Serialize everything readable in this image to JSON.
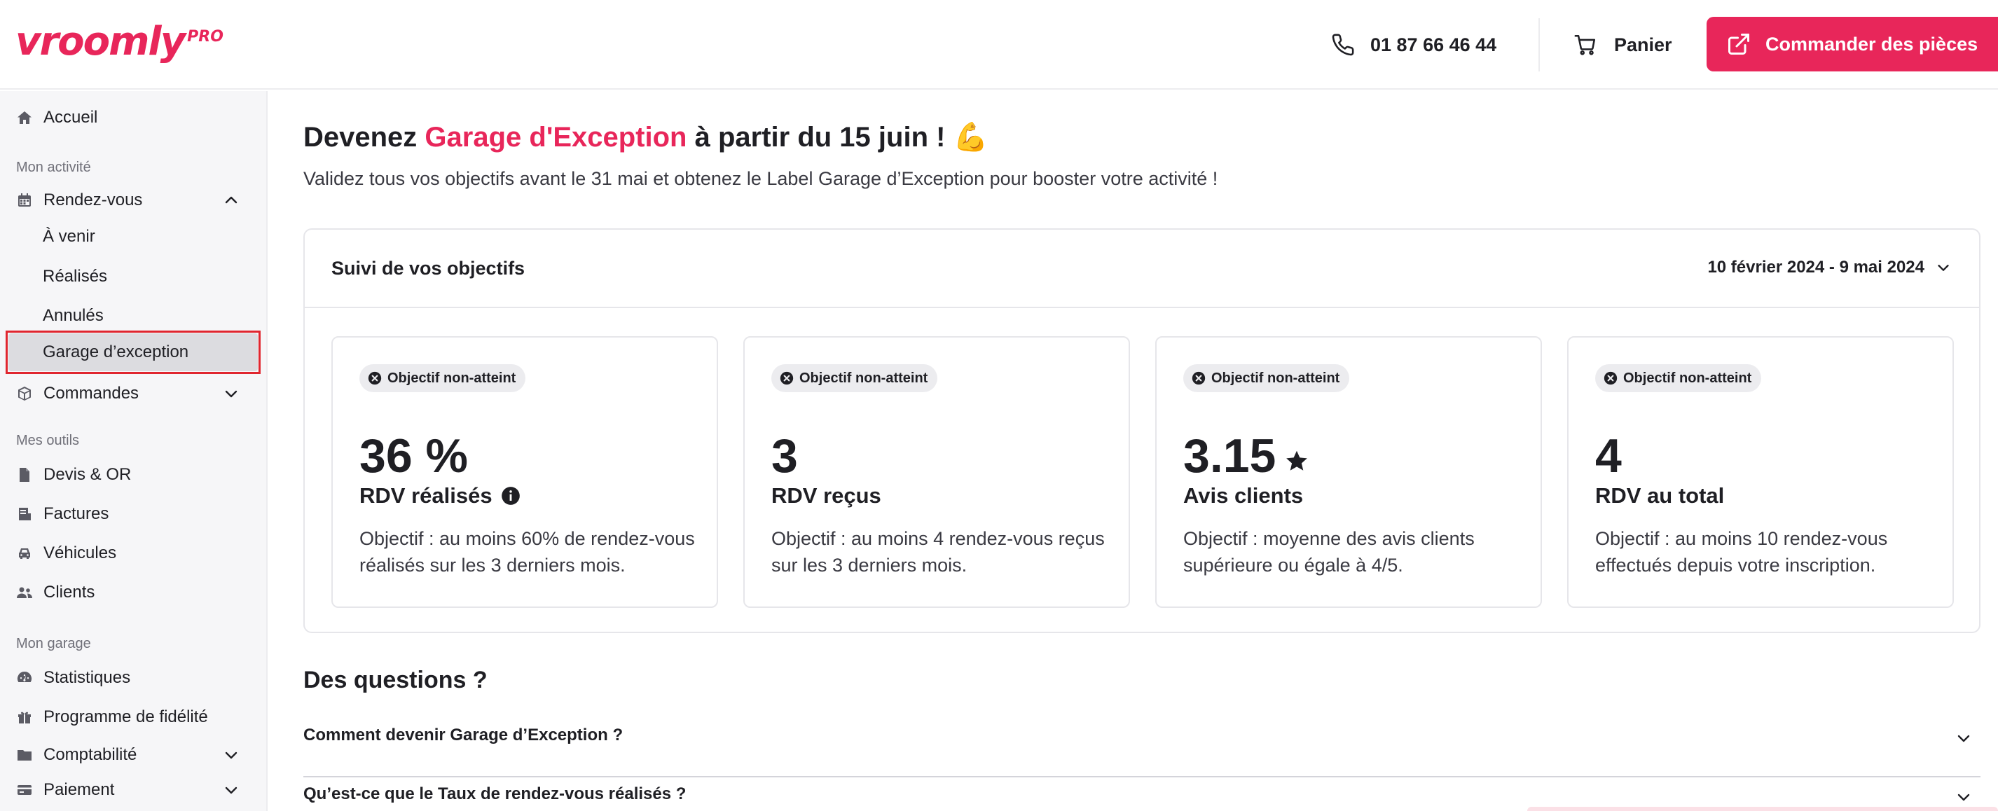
{
  "header": {
    "logo_text": "vroomly",
    "logo_suffix": "PRO",
    "phone": "01 87 66 46 44",
    "cart_label": "Panier",
    "order_button_label": "Commander des pièces",
    "accent_color": "#e8265a"
  },
  "sidebar": {
    "home": "Accueil",
    "section_activity": "Mon activité",
    "appointments": "Rendez-vous",
    "appointments_sub": [
      "À venir",
      "Réalisés",
      "Annulés",
      "Garage d’exception"
    ],
    "orders": "Commandes",
    "section_tools": "Mes outils",
    "tools": [
      "Devis & OR",
      "Factures",
      "Véhicules",
      "Clients"
    ],
    "section_garage": "Mon garage",
    "garage": [
      "Statistiques",
      "Programme de fidélité",
      "Comptabilité",
      "Paiement"
    ]
  },
  "main": {
    "title_prefix": "Devenez ",
    "title_accent": "Garage d'Exception",
    "title_suffix": " à partir du 15 juin !",
    "title_emoji": "💪",
    "subtitle": "Validez tous vos objectifs avant le 31 mai et obtenez le Label Garage d’Exception pour booster votre activité !",
    "panel_title": "Suivi de vos objectifs",
    "date_range": "10 février 2024 - 9 mai 2024",
    "cards": [
      {
        "badge": "Objectif non-atteint",
        "value": "36 %",
        "label": "RDV réalisés",
        "desc": "Objectif : au moins 60% de rendez-vous réalisés sur les 3 derniers mois."
      },
      {
        "badge": "Objectif non-atteint",
        "value": "3",
        "label": "RDV reçus",
        "desc": "Objectif : au moins 4 rendez-vous reçus sur les 3 derniers mois."
      },
      {
        "badge": "Objectif non-atteint",
        "value": "3.15",
        "label": "Avis clients",
        "desc": "Objectif : moyenne des avis clients supérieure ou égale à 4/5."
      },
      {
        "badge": "Objectif non-atteint",
        "value": "4",
        "label": "RDV au total",
        "desc": "Objectif : au moins 10 rendez-vous effectués depuis votre inscription."
      }
    ],
    "faq_title": "Des questions ?",
    "faq": [
      "Comment devenir Garage d’Exception ?",
      "Qu’est-ce que le Taux de rendez-vous réalisés ?"
    ]
  }
}
